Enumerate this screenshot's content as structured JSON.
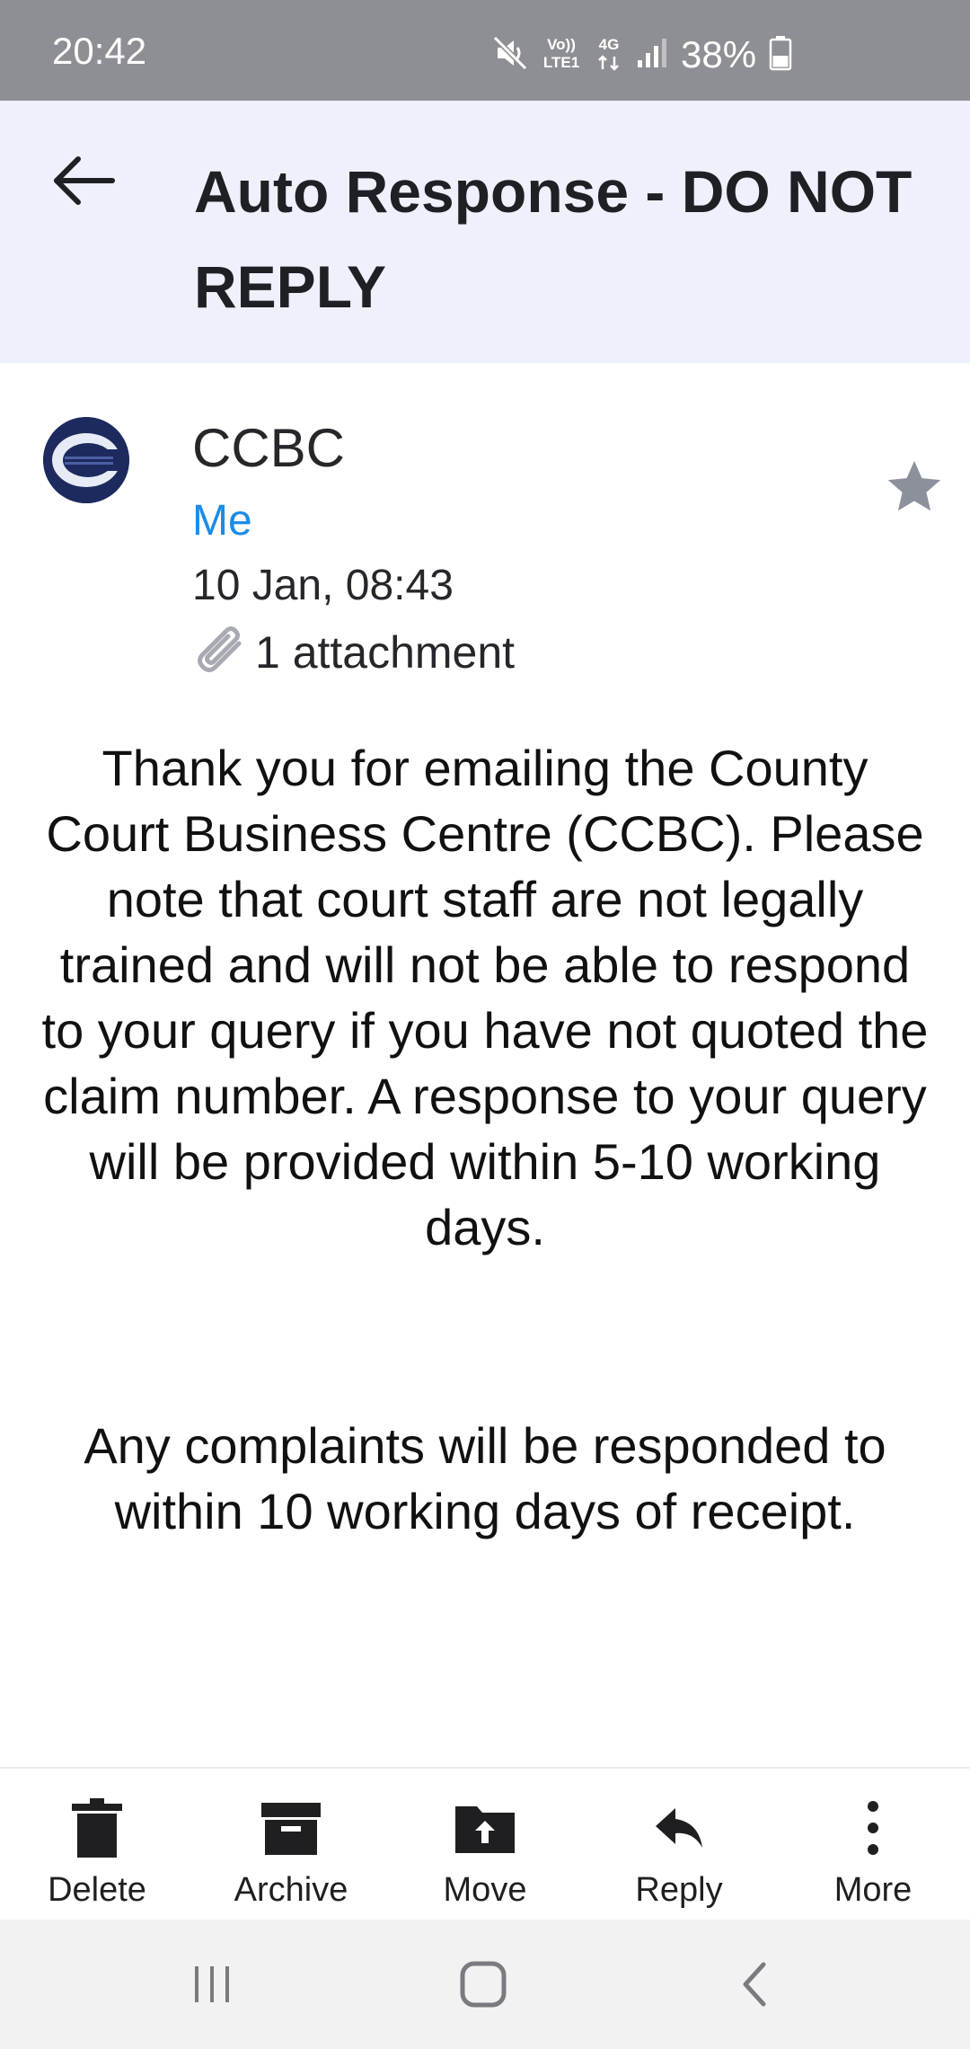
{
  "status_bar": {
    "time": "20:42",
    "network_lte_label": "Vo)) LTE1",
    "network_4g_label": "4G",
    "battery_percent": "38%",
    "icons": [
      "mute-icon",
      "volte-icon",
      "4g-data-icon",
      "signal-icon",
      "battery-icon"
    ]
  },
  "header": {
    "title": "Auto Response - DO NOT REPLY",
    "back_icon": "arrow-left-icon"
  },
  "message": {
    "sender_name": "CCBC",
    "recipient": "Me",
    "date": "10 Jan, 08:43",
    "attachment_label": "1 attachment",
    "starred": false
  },
  "body": {
    "paragraph_1": "Thank you for emailing the County Court Business Centre (CCBC). Please note that court staff are not legally trained and will not be able to respond to your query if you have not quoted the claim number. A response to your query will be provided within 5-10 working days.",
    "paragraph_2": "Any complaints will be responded to within 10 working days of receipt."
  },
  "actions": [
    {
      "label": "Delete",
      "icon": "trash-icon"
    },
    {
      "label": "Archive",
      "icon": "archive-icon"
    },
    {
      "label": "Move",
      "icon": "folder-move-icon"
    },
    {
      "label": "Reply",
      "icon": "reply-icon"
    },
    {
      "label": "More",
      "icon": "more-vertical-icon"
    }
  ],
  "nav": [
    "recent-apps-icon",
    "home-icon",
    "back-icon"
  ],
  "colors": {
    "status_bar_bg": "#8e8f94",
    "header_bg": "#eef1fc",
    "recipient_blue": "#1a8ce8",
    "avatar_navy": "#1d2a5e",
    "star_gray": "#8c909b"
  }
}
